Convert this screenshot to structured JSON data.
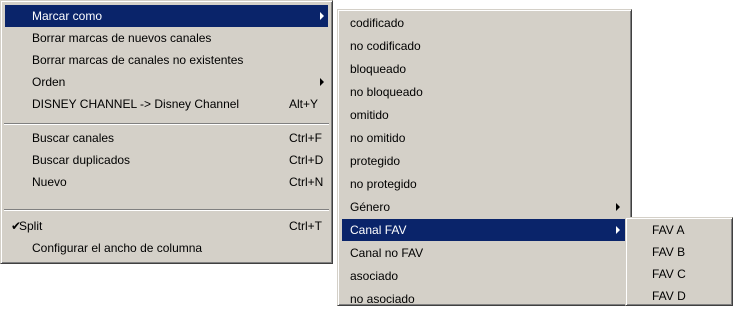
{
  "main_menu": {
    "items": [
      {
        "label": "Marcar como",
        "shortcut": "",
        "submenu": true
      },
      {
        "label": "Borrar marcas de nuevos canales",
        "shortcut": "",
        "submenu": false
      },
      {
        "label": "Borrar marcas de canales no existentes",
        "shortcut": "",
        "submenu": false
      },
      {
        "label": "Orden",
        "shortcut": "",
        "submenu": true
      },
      {
        "label": "DISNEY CHANNEL -> Disney Channel",
        "shortcut": "Alt+Y",
        "submenu": false
      },
      {
        "label": "Buscar canales",
        "shortcut": "Ctrl+F",
        "submenu": false
      },
      {
        "label": "Buscar duplicados",
        "shortcut": "Ctrl+D",
        "submenu": false
      },
      {
        "label": "Nuevo",
        "shortcut": "Ctrl+N",
        "submenu": false
      },
      {
        "label": "Split",
        "shortcut": "Ctrl+T",
        "submenu": false,
        "checked": true
      },
      {
        "label": "Configurar el ancho de columna",
        "shortcut": "",
        "submenu": false
      }
    ]
  },
  "mark_submenu": {
    "items": [
      {
        "label": "codificado"
      },
      {
        "label": "no codificado"
      },
      {
        "label": "bloqueado"
      },
      {
        "label": "no bloqueado"
      },
      {
        "label": "omitido"
      },
      {
        "label": "no omitido"
      },
      {
        "label": "protegido"
      },
      {
        "label": "no protegido"
      },
      {
        "label": "Género",
        "submenu": true
      },
      {
        "label": "Canal FAV",
        "submenu": true
      },
      {
        "label": "Canal no FAV"
      },
      {
        "label": "asociado"
      },
      {
        "label": "no asociado"
      }
    ]
  },
  "fav_submenu": {
    "items": [
      {
        "label": "FAV A"
      },
      {
        "label": "FAV B"
      },
      {
        "label": "FAV C"
      },
      {
        "label": "FAV D"
      }
    ]
  },
  "colors": {
    "menu_background": "#d4d0c8",
    "highlight": "#0a246a",
    "highlight_text": "#ffffff"
  },
  "icons": {
    "check": "check-icon",
    "submenu_arrow": "submenu-arrow-icon"
  }
}
